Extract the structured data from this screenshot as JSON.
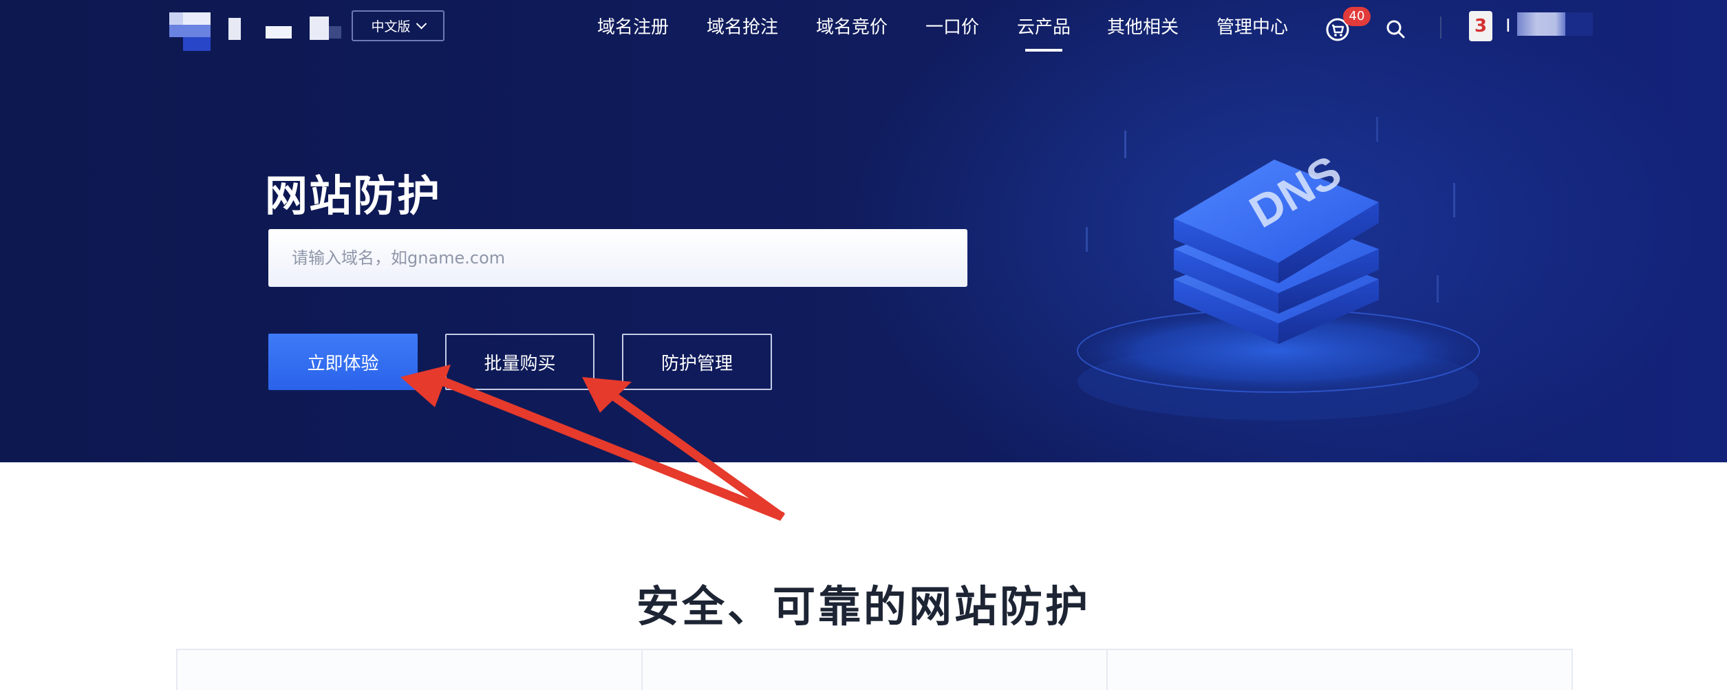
{
  "brand": {
    "logo_icon": "blurred-logo"
  },
  "header": {
    "language_label": "中文版",
    "nav": [
      {
        "label": "域名注册"
      },
      {
        "label": "域名抢注"
      },
      {
        "label": "域名竞价"
      },
      {
        "label": "一口价"
      },
      {
        "label": "云产品",
        "active": true
      },
      {
        "label": "其他相关"
      },
      {
        "label": "管理中心"
      }
    ],
    "cart_count": "40",
    "cart_icon": "cart-icon",
    "search_icon": "search-icon",
    "user_avatar_text": "3",
    "user_id_prefix": "I"
  },
  "hero": {
    "title": "网站防护",
    "input_placeholder": "请输入域名，如gname.com",
    "buttons": {
      "try": "立即体验",
      "bulk_buy": "批量购买",
      "manage": "防护管理"
    },
    "illustration_text": "DNS"
  },
  "section": {
    "title": "安全、可靠的网站防护"
  },
  "colors": {
    "hero_bg": "#101c5e",
    "primary_button": "#2f6af0",
    "annotation_arrow": "#e63a2c",
    "badge": "#e23b3b"
  }
}
